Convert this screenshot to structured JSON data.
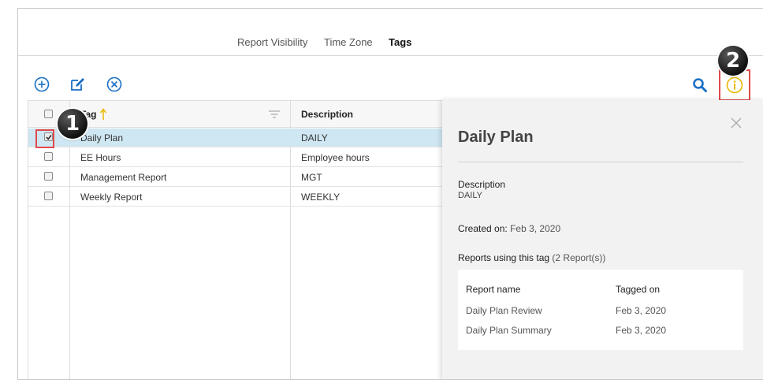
{
  "tabs": [
    {
      "label": "Report Visibility",
      "active": false
    },
    {
      "label": "Time Zone",
      "active": false
    },
    {
      "label": "Tags",
      "active": true
    }
  ],
  "toolbar": {
    "icons": [
      "add-icon",
      "edit-icon",
      "cancel-icon",
      "search-icon",
      "info-icon"
    ]
  },
  "callouts": [
    "1",
    "2"
  ],
  "table": {
    "headers": {
      "tag": "Tag",
      "description": "Description"
    },
    "rows": [
      {
        "tag": "Daily Plan",
        "description": "DAILY",
        "checked": true
      },
      {
        "tag": "EE Hours",
        "description": "Employee hours",
        "checked": false
      },
      {
        "tag": "Management Report",
        "description": "MGT",
        "checked": false
      },
      {
        "tag": "Weekly Report",
        "description": "WEEKLY",
        "checked": false
      }
    ]
  },
  "panel": {
    "title": "Daily Plan",
    "description_label": "Description",
    "description_value": "DAILY",
    "created_label": "Created on:",
    "created_value": "Feb 3, 2020",
    "reports_label": "Reports using this tag",
    "reports_count": "(2 Report(s))",
    "reports_headers": {
      "name": "Report name",
      "tagged": "Tagged on"
    },
    "reports": [
      {
        "name": "Daily Plan Review",
        "tagged": "Feb 3, 2020"
      },
      {
        "name": "Daily Plan Summary",
        "tagged": "Feb 3, 2020"
      }
    ]
  },
  "colors": {
    "accent": "#1a6fc4",
    "info": "#e8b800",
    "highlight": "#e04a4a",
    "selected_row": "#cfe7f3"
  }
}
